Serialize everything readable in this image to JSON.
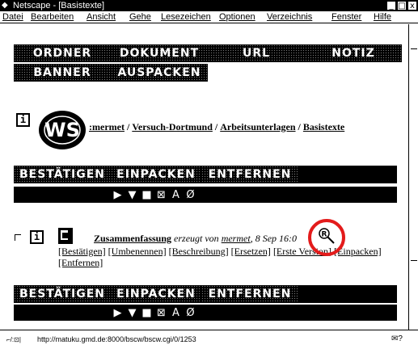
{
  "window": {
    "title": "Netscape - [Basistexte]",
    "controls": {
      "minimize": "_",
      "maximize": "□",
      "close": "x"
    }
  },
  "menu": [
    "Datei",
    "Bearbeiten",
    "Ansicht",
    "Gehe",
    "Lesezeichen",
    "Optionen",
    "Verzeichnis",
    "Fenster",
    "Hilfe"
  ],
  "top_buttons": {
    "row1": [
      "ORDNER",
      "DOKUMENT",
      "URL",
      "NOTIZ"
    ],
    "row2": [
      "BANNER",
      "AUSPACKEN"
    ]
  },
  "logo_text": "WS",
  "info_icon": "i",
  "breadcrumb": [
    ":mermet",
    "Versuch-Dortmund",
    "Arbeitsunterlagen",
    "Basistexte"
  ],
  "breadcrumb_separator": "/",
  "action_bar": [
    "BESTÄTIGEN",
    "EINPACKEN",
    "ENTFERNEN"
  ],
  "action_bar_bottom": [
    "BESTÄTIGEN",
    "EINPACKEN",
    "ENTFERNEN"
  ],
  "control_glyphs": [
    "▶",
    "▼",
    "■",
    "⊠",
    "A",
    "Ø"
  ],
  "item": {
    "title": "Zusammenfassung",
    "desc": "erzeugt von",
    "user": "mermet",
    "date": ", 8 Sep 16:0"
  },
  "item_actions": [
    "[Bestätigen]",
    "[Umbenennen]",
    "[Beschreibung]",
    "[Ersetzen]",
    "[Erste Version]",
    "[Einpacken]",
    "[Entfernen]"
  ],
  "status": {
    "url": "http://matuku.gmd.de:8000/bscw/bscw.cgi/0/1253",
    "left_icon": "⌐/:⊡|",
    "mail_icon": "✉?"
  },
  "colors": {
    "highlight_circle": "#e31b1b"
  }
}
